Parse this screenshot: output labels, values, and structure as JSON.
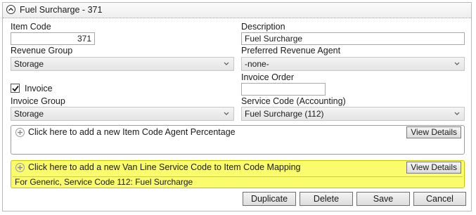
{
  "panel": {
    "title": "Fuel Surcharge - 371"
  },
  "form": {
    "item_code": {
      "label": "Item Code",
      "value": "371"
    },
    "description": {
      "label": "Description",
      "value": "Fuel Surcharge"
    },
    "revenue_group": {
      "label": "Revenue Group",
      "value": "Storage"
    },
    "preferred_revenue_agent": {
      "label": "Preferred Revenue Agent",
      "value": "-none-"
    },
    "invoice_order": {
      "label": "Invoice Order",
      "value": ""
    },
    "invoice_checkbox": {
      "label": "Invoice",
      "checked": true
    },
    "invoice_group": {
      "label": "Invoice Group",
      "value": "Storage"
    },
    "service_code": {
      "label": "Service Code (Accounting)",
      "value": "Fuel Surcharge (112)"
    }
  },
  "agent_percentage": {
    "add_text": "Click here to add a new Item Code Agent Percentage",
    "view_details_label": "View Details"
  },
  "van_line_mapping": {
    "add_text": "Click here to add a new Van Line Service Code to Item Code Mapping",
    "view_details_label": "View Details",
    "rows": [
      "For Generic, Service Code 112: Fuel Surcharge"
    ],
    "highlight_color": "#fbfb6e"
  },
  "actions": {
    "duplicate_label": "Duplicate",
    "delete_label": "Delete",
    "save_label": "Save",
    "cancel_label": "Cancel"
  }
}
